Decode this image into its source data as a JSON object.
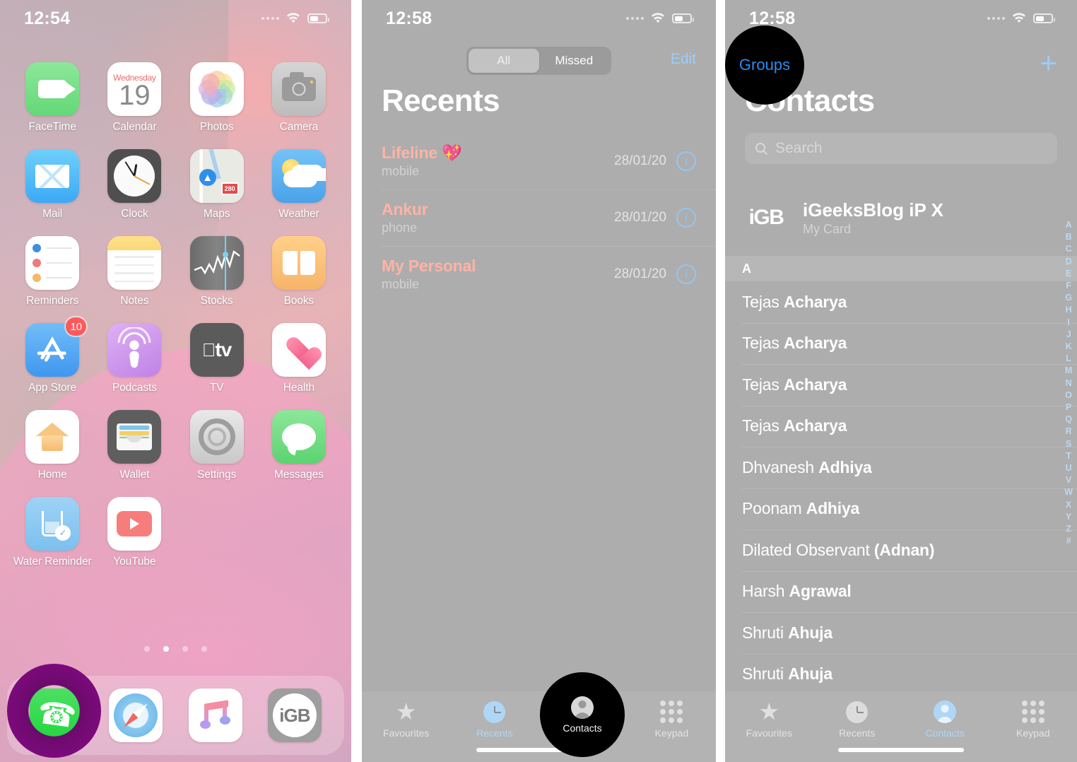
{
  "colors": {
    "accent_blue": "#2a8cf0",
    "tint_blue": "#9dcdf5",
    "call_name": "#ffb3a7",
    "panel_bg": "#adadad",
    "highlight_dark": "#000000",
    "highlight_purple": "#8c0a8c"
  },
  "panel1": {
    "name": "iphone-home-screen",
    "status": {
      "time": "12:54",
      "wifi": "wifi-icon",
      "battery": "battery-icon",
      "signal": "signal-dots-icon"
    },
    "apps": [
      {
        "label": "FaceTime",
        "icon": "facetime-icon"
      },
      {
        "label": "Calendar",
        "icon": "calendar-icon",
        "day": "Wednesday",
        "date": "19"
      },
      {
        "label": "Photos",
        "icon": "photos-icon"
      },
      {
        "label": "Camera",
        "icon": "camera-icon"
      },
      {
        "label": "Mail",
        "icon": "mail-icon"
      },
      {
        "label": "Clock",
        "icon": "clock-icon"
      },
      {
        "label": "Maps",
        "icon": "maps-icon",
        "shield": "280"
      },
      {
        "label": "Weather",
        "icon": "weather-icon"
      },
      {
        "label": "Reminders",
        "icon": "reminders-icon"
      },
      {
        "label": "Notes",
        "icon": "notes-icon"
      },
      {
        "label": "Stocks",
        "icon": "stocks-icon"
      },
      {
        "label": "Books",
        "icon": "books-icon"
      },
      {
        "label": "App Store",
        "icon": "app-store-icon",
        "badge": "10"
      },
      {
        "label": "Podcasts",
        "icon": "podcasts-icon"
      },
      {
        "label": "TV",
        "icon": "apple-tv-icon",
        "glyph": "tv"
      },
      {
        "label": "Health",
        "icon": "health-icon"
      },
      {
        "label": "Home",
        "icon": "home-icon"
      },
      {
        "label": "Wallet",
        "icon": "wallet-icon"
      },
      {
        "label": "Settings",
        "icon": "settings-icon"
      },
      {
        "label": "Messages",
        "icon": "messages-icon"
      },
      {
        "label": "Water Reminder",
        "icon": "water-reminder-icon"
      },
      {
        "label": "YouTube",
        "icon": "youtube-icon"
      }
    ],
    "page_dots": {
      "count": 4,
      "active_index": 1
    },
    "dock": [
      {
        "label": "Phone",
        "icon": "phone-icon",
        "highlighted": true
      },
      {
        "label": "Safari",
        "icon": "safari-icon"
      },
      {
        "label": "Music",
        "icon": "music-icon"
      },
      {
        "label": "iGB",
        "icon": "igeeksblog-icon",
        "glyph": "iGB"
      }
    ]
  },
  "panel2": {
    "name": "phone-recents-screen",
    "status": {
      "time": "12:58"
    },
    "segments": [
      {
        "label": "All",
        "active": true
      },
      {
        "label": "Missed",
        "active": false
      }
    ],
    "edit_label": "Edit",
    "title": "Recents",
    "calls": [
      {
        "name": "Lifeline 💖",
        "type": "mobile",
        "date": "28/01/20",
        "info": "i"
      },
      {
        "name": "Ankur",
        "type": "phone",
        "date": "28/01/20",
        "info": "i"
      },
      {
        "name": "My Personal",
        "type": "mobile",
        "date": "28/01/20",
        "info": "i"
      }
    ],
    "tabs": [
      {
        "label": "Favourites",
        "icon": "star-icon",
        "active": false
      },
      {
        "label": "Recents",
        "icon": "clock-icon",
        "active": true
      },
      {
        "label": "Contacts",
        "icon": "person-circle-icon",
        "active": false,
        "highlighted": true
      },
      {
        "label": "Keypad",
        "icon": "keypad-icon",
        "active": false
      }
    ]
  },
  "panel3": {
    "name": "contacts-screen",
    "status": {
      "time": "12:58"
    },
    "groups_label": "Groups",
    "add_label": "+",
    "title": "Contacts",
    "search": {
      "placeholder": "Search",
      "icon": "search-icon"
    },
    "my_card": {
      "avatar": "iGB",
      "name": "iGeeksBlog iP X",
      "subtitle": "My Card"
    },
    "section_header": "A",
    "contacts": [
      {
        "first": "Tejas ",
        "last": "Acharya"
      },
      {
        "first": "Tejas ",
        "last": "Acharya"
      },
      {
        "first": "Tejas ",
        "last": "Acharya"
      },
      {
        "first": "Tejas ",
        "last": "Acharya"
      },
      {
        "first": "Dhvanesh ",
        "last": "Adhiya"
      },
      {
        "first": "Poonam ",
        "last": "Adhiya"
      },
      {
        "first": "Dilated Observant ",
        "last": "(Adnan)"
      },
      {
        "first": "Harsh ",
        "last": "Agrawal"
      },
      {
        "first": "Shruti ",
        "last": "Ahuja"
      },
      {
        "first": "Shruti ",
        "last": "Ahuja"
      }
    ],
    "alpha_index": [
      "A",
      "B",
      "C",
      "D",
      "E",
      "F",
      "G",
      "H",
      "I",
      "J",
      "K",
      "L",
      "M",
      "N",
      "O",
      "P",
      "Q",
      "R",
      "S",
      "T",
      "U",
      "V",
      "W",
      "X",
      "Y",
      "Z",
      "#"
    ],
    "tabs": [
      {
        "label": "Favourites",
        "icon": "star-icon",
        "active": false
      },
      {
        "label": "Recents",
        "icon": "clock-icon",
        "active": false
      },
      {
        "label": "Contacts",
        "icon": "person-circle-icon",
        "active": true
      },
      {
        "label": "Keypad",
        "icon": "keypad-icon",
        "active": false
      }
    ]
  }
}
